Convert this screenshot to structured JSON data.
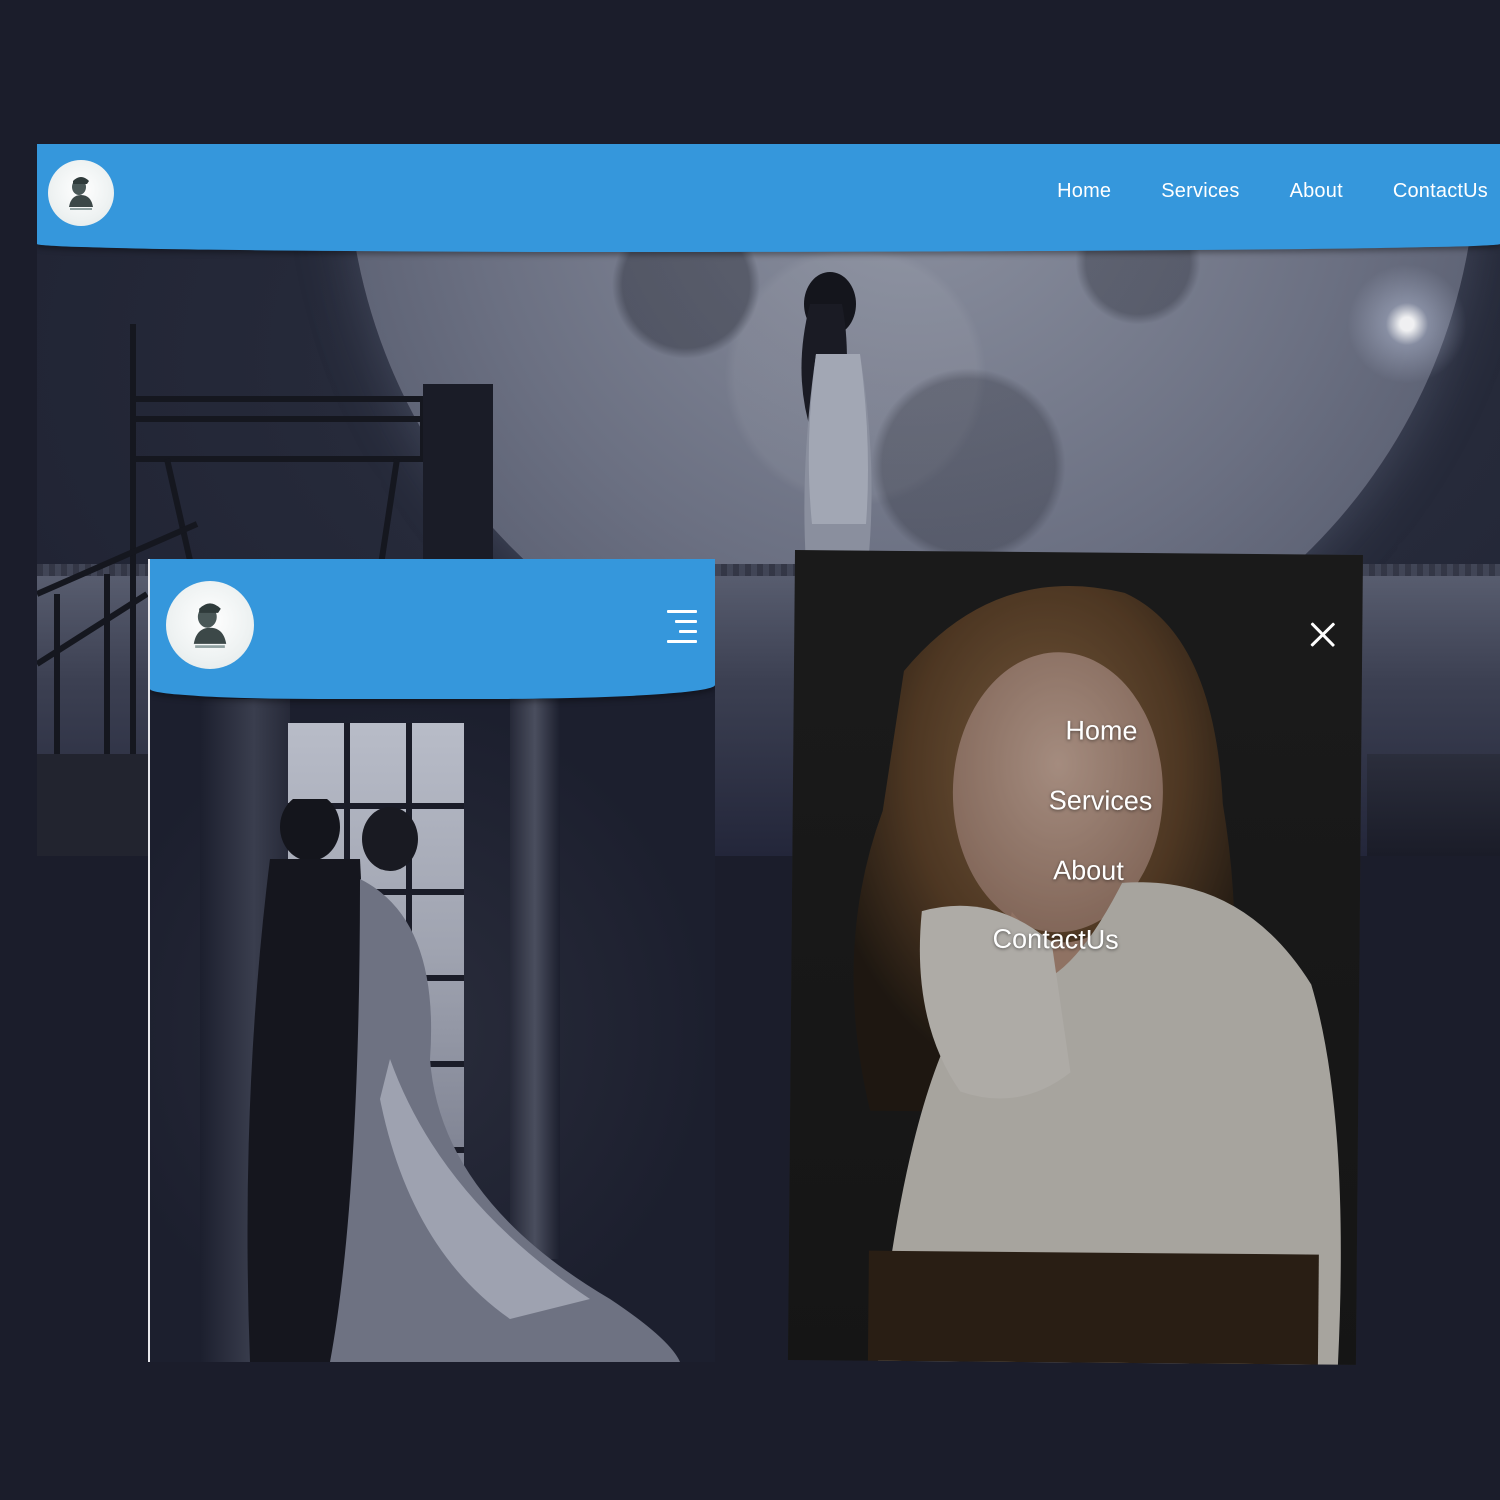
{
  "desktop": {
    "nav": {
      "home": "Home",
      "services": "Services",
      "about": "About",
      "contact": "ContactUs"
    },
    "logo_icon": "logo-portrait-icon"
  },
  "mobile": {
    "logo_icon": "logo-portrait-icon",
    "menu_icon": "hamburger-icon"
  },
  "mobile_menu": {
    "close_icon": "close-icon",
    "items": [
      "Home",
      "Services",
      "About",
      "ContactUs"
    ]
  },
  "colors": {
    "header": "#3597dc",
    "background": "#1b1d2b",
    "menu_text": "#ffffff"
  }
}
